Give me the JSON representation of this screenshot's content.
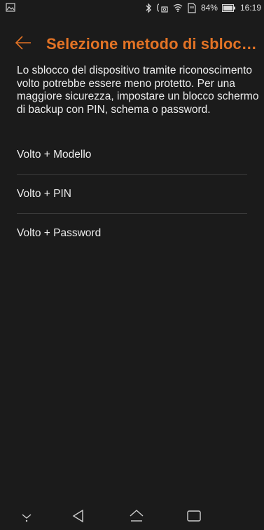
{
  "status_bar": {
    "battery": "84%",
    "time": "16:19",
    "icons": [
      "image-icon",
      "bluetooth-icon",
      "vibrate-icon",
      "wifi-icon",
      "sim-icon",
      "battery-icon"
    ]
  },
  "header": {
    "back_icon": "back-arrow-icon",
    "title": "Selezione metodo di sbloc…"
  },
  "description": "Lo sblocco del dispositivo tramite riconoscimento volto potrebbe essere meno protetto. Per una maggiore sicurezza, impostare un blocco schermo di backup con PIN, schema o password.",
  "options": [
    {
      "label": "Volto + Modello"
    },
    {
      "label": "Volto + PIN"
    },
    {
      "label": "Volto + Password"
    }
  ],
  "nav_bar": {
    "icons": [
      "collapse-icon",
      "back-icon",
      "home-icon",
      "recents-icon"
    ]
  },
  "colors": {
    "background": "#1b1b1b",
    "accent": "#e37325",
    "text": "#ededed",
    "divider": "#3a3a3a"
  }
}
